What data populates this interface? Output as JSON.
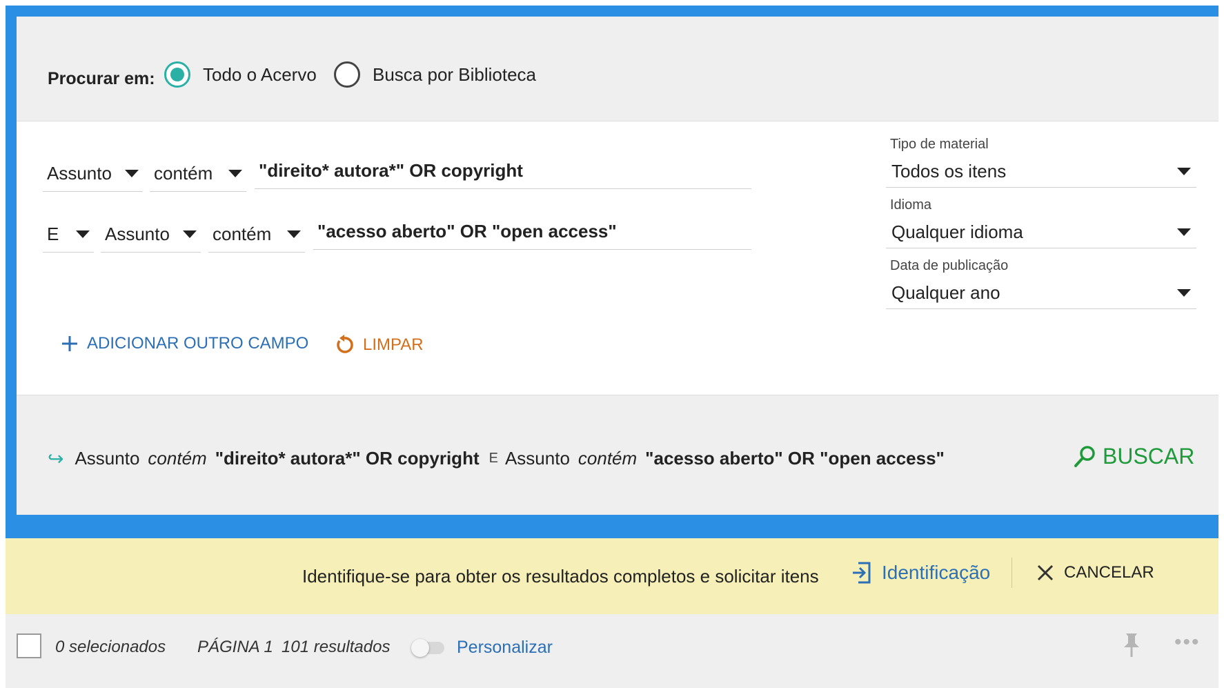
{
  "scope": {
    "label": "Procurar em:",
    "options": [
      {
        "label": "Todo o Acervo",
        "selected": true
      },
      {
        "label": "Busca por Biblioteca",
        "selected": false
      }
    ]
  },
  "query_rows": [
    {
      "field": "Assunto",
      "operator": "contém",
      "value": "\"direito* autora*\" OR copyright"
    },
    {
      "boolean": "E",
      "field": "Assunto",
      "operator": "contém",
      "value": "\"acesso aberto\" OR \"open access\""
    }
  ],
  "facets": {
    "material": {
      "label": "Tipo de material",
      "value": "Todos os itens"
    },
    "language": {
      "label": "Idioma",
      "value": "Qualquer idioma"
    },
    "date": {
      "label": "Data de publicação",
      "value": "Qualquer ano"
    }
  },
  "actions": {
    "add_field": "ADICIONAR OUTRO CAMPO",
    "clear": "LIMPAR"
  },
  "summary": {
    "field1": "Assunto",
    "op1": "contém",
    "value1": "\"direito* autora*\" OR copyright",
    "boolean": "E",
    "field2": "Assunto",
    "op2": "contém",
    "value2": "\"acesso aberto\" OR \"open access\"",
    "search_button": "BUSCAR"
  },
  "banner": {
    "message": "Identifique-se para obter os resultados completos e solicitar itens",
    "login": "Identificação",
    "cancel": "CANCELAR"
  },
  "results": {
    "selected": "0 selecionados",
    "page": "PÁGINA 1",
    "count": "101 resultados",
    "customize": "Personalizar"
  },
  "colors": {
    "frame": "#2b8fe3",
    "radio_accent": "#2bb0a6",
    "link": "#2c6fb5",
    "clear": "#d26f1d",
    "search": "#1f9a3a",
    "banner": "#f6f0b8"
  }
}
